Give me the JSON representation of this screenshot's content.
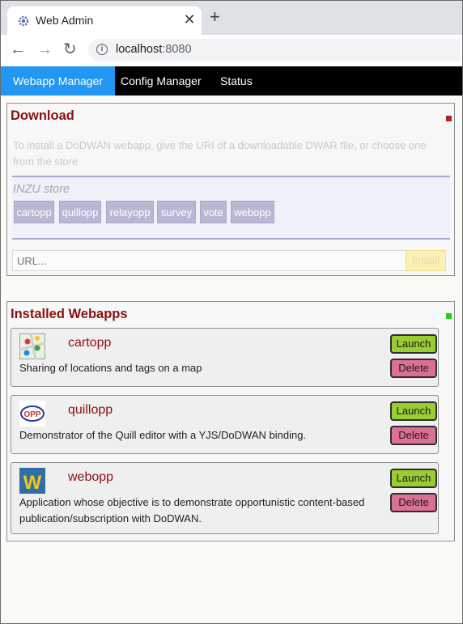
{
  "browser": {
    "tab_title": "Web Admin",
    "tab_close": "✕",
    "new_tab": "+",
    "back": "←",
    "forward": "→",
    "reload": "↻",
    "url_host": "localhost",
    "url_port": ":8080"
  },
  "menu": {
    "items": [
      "Webapp Manager",
      "Config Manager",
      "Status"
    ],
    "active": "Webapp Manager"
  },
  "download": {
    "title": "Download",
    "intro": "To install a DoDWAN webapp, give the URI of a downloadable DWAR file, or choose one from the store",
    "store_title": "INZU store",
    "store_apps": [
      "cartopp",
      "quillopp",
      "relayopp",
      "survey",
      "vote",
      "webopp"
    ],
    "url_placeholder": "URL...",
    "install_label": "Install",
    "marker_color": "#b22222"
  },
  "installed": {
    "title": "Installed Webapps",
    "marker_color": "#22cc22",
    "apps": [
      {
        "name": "cartopp",
        "description": "Sharing of locations and tags on a map",
        "icon": "map-icon",
        "launch": "Launch",
        "delete": "Delete"
      },
      {
        "name": "quillopp",
        "description": "Demonstrator of the Quill editor with a YJS/DoDWAN binding.",
        "icon": "quill-logo-icon",
        "icon_text": "OPP",
        "launch": "Launch",
        "delete": "Delete"
      },
      {
        "name": "webopp",
        "description": "Application whose objective is to demonstrate opportunistic content-based publication/subscription with DoDWAN.",
        "icon": "w-logo-icon",
        "icon_text": "W",
        "launch": "Launch",
        "delete": "Delete"
      }
    ]
  },
  "colors": {
    "menu_active": "#2196f3",
    "title": "#8b1010",
    "launch": "#9acd32",
    "delete": "#db7093"
  }
}
